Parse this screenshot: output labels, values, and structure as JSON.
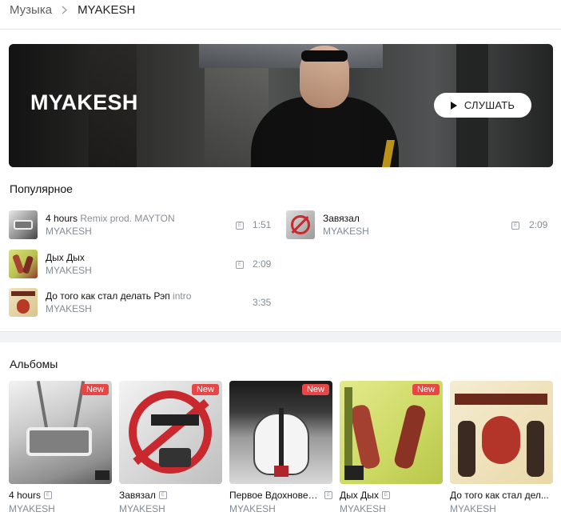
{
  "breadcrumb": {
    "root": "Музыка",
    "current": "MYAKESH"
  },
  "hero": {
    "title": "MYAKESH",
    "play_label": "СЛУШАТЬ"
  },
  "popular": {
    "heading": "Популярное",
    "tracks": [
      {
        "title": "4 hours",
        "subtitle": "Remix prod. MAYTON",
        "artist": "MYAKESH",
        "explicit": "E",
        "duration": "1:51"
      },
      {
        "title": "Дых Дых",
        "subtitle": "",
        "artist": "MYAKESH",
        "explicit": "E",
        "duration": "2:09"
      },
      {
        "title": "До того как стал делать Рэп",
        "subtitle": "intro",
        "artist": "MYAKESH",
        "explicit": "",
        "duration": "3:35"
      },
      {
        "title": "Завязал",
        "subtitle": "",
        "artist": "MYAKESH",
        "explicit": "E",
        "duration": "2:09"
      }
    ]
  },
  "albums": {
    "heading": "Альбомы",
    "items": [
      {
        "title": "4 hours",
        "artist": "MYAKESH",
        "explicit": "E",
        "badge": "New"
      },
      {
        "title": "Завязал",
        "artist": "MYAKESH",
        "explicit": "E",
        "badge": "New"
      },
      {
        "title": "Первое Вдохновен...",
        "artist": "MYAKESH",
        "explicit": "E",
        "badge": "New"
      },
      {
        "title": "Дых Дых",
        "artist": "MYAKESH",
        "explicit": "E",
        "badge": "New"
      },
      {
        "title": "До того как стал дел...",
        "artist": "MYAKESH",
        "explicit": "",
        "badge": ""
      }
    ]
  },
  "colors": {
    "new_badge": "#e64646",
    "secondary_text": "#818c99"
  }
}
